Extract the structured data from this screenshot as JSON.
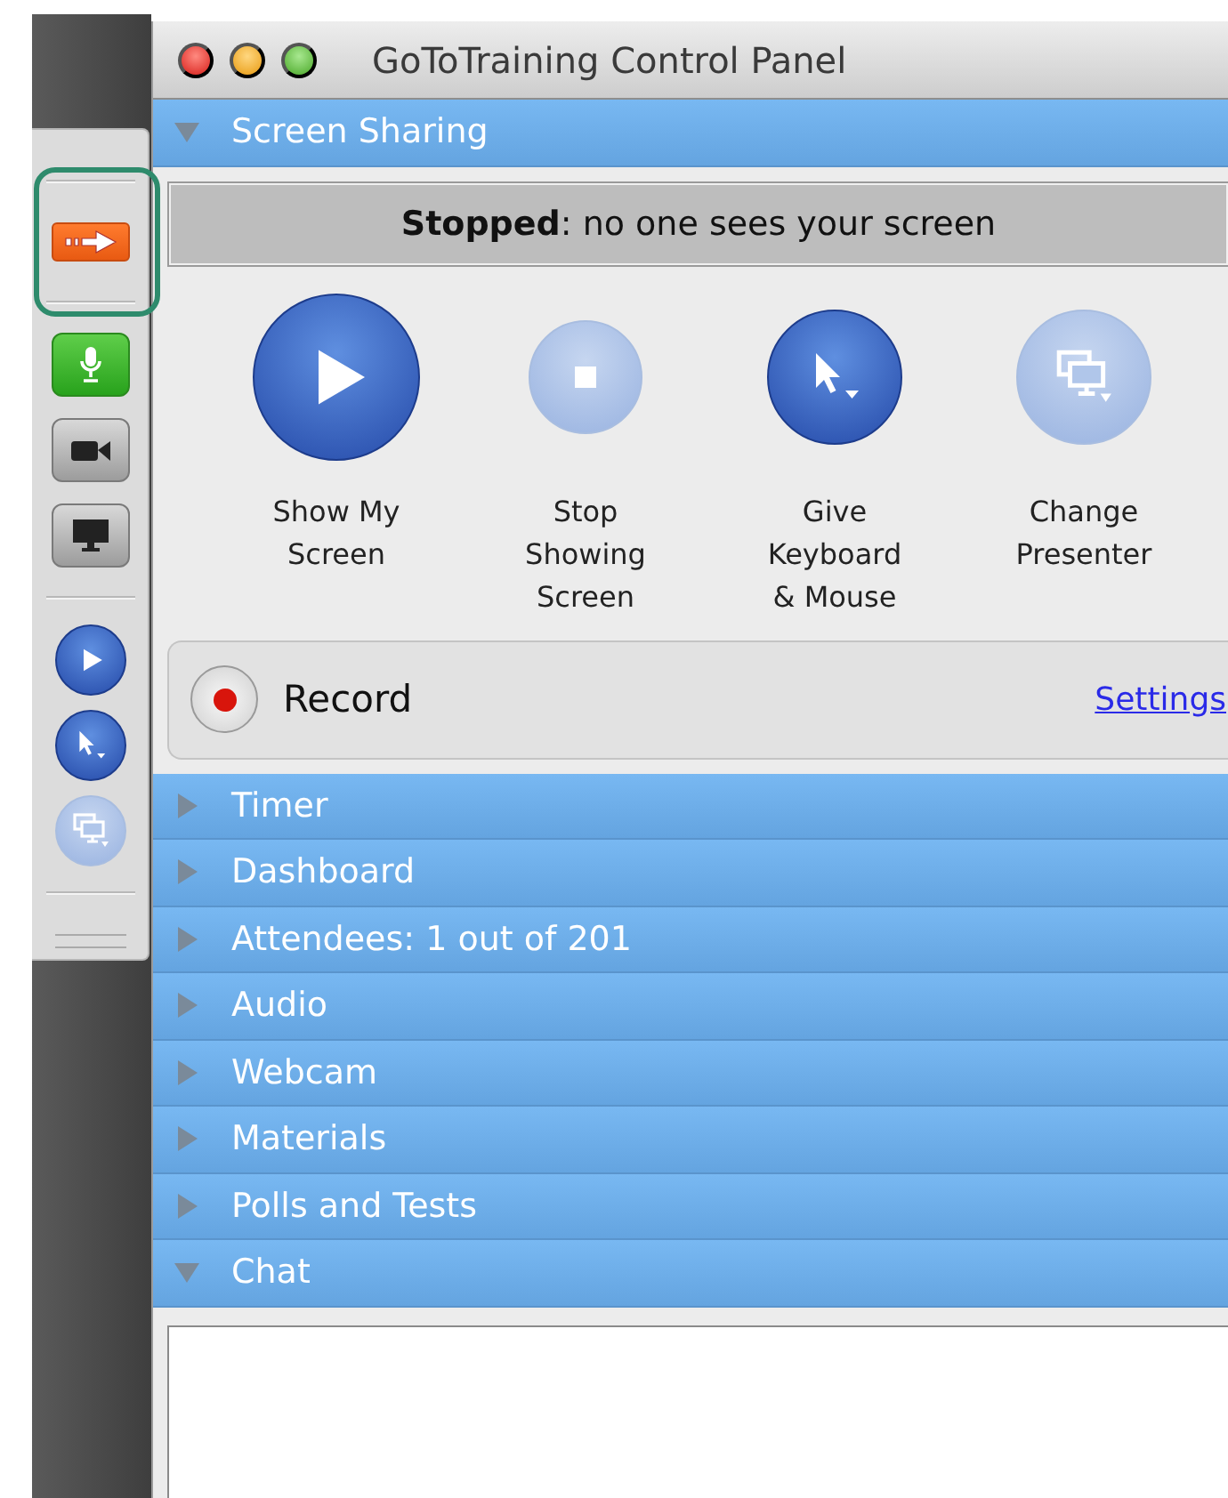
{
  "window": {
    "title": "GoToTraining Control Panel"
  },
  "toolbar": {
    "items": [
      {
        "kind": "share-arrow",
        "highlighted": true
      },
      {
        "kind": "mic",
        "highlighted": false
      },
      {
        "kind": "camera",
        "highlighted": false
      },
      {
        "kind": "monitor",
        "highlighted": false
      },
      {
        "kind": "play",
        "highlighted": false
      },
      {
        "kind": "pointer",
        "highlighted": false
      },
      {
        "kind": "presenter",
        "highlighted": false
      }
    ]
  },
  "sections": [
    {
      "kind": "screen_sharing",
      "title": "Screen Sharing",
      "expanded": true,
      "status": "**Stopped**: no one sees your screen",
      "actions": [
        {
          "kind": "play",
          "label": "Show My Screen",
          "disabled": false
        },
        {
          "kind": "stop",
          "label": "Stop Showing Screen",
          "disabled": true
        },
        {
          "kind": "pointer",
          "label": "Give Keyboard & Mouse",
          "disabled": false
        },
        {
          "kind": "presenter",
          "label": "Change Presenter",
          "disabled": true
        }
      ],
      "record": {
        "label": "Record",
        "link": "Settings"
      }
    },
    {
      "kind": "plain",
      "title": "Timer",
      "expanded": false
    },
    {
      "kind": "plain",
      "title": "Dashboard",
      "expanded": false
    },
    {
      "kind": "plain",
      "title": "Attendees: 1 out of 201",
      "expanded": false
    },
    {
      "kind": "plain",
      "title": "Audio",
      "expanded": false
    },
    {
      "kind": "plain",
      "title": "Webcam",
      "expanded": false
    },
    {
      "kind": "plain",
      "title": "Materials",
      "expanded": false
    },
    {
      "kind": "plain",
      "title": "Polls and Tests",
      "expanded": false
    },
    {
      "kind": "chat",
      "title": "Chat",
      "expanded": true
    }
  ]
}
